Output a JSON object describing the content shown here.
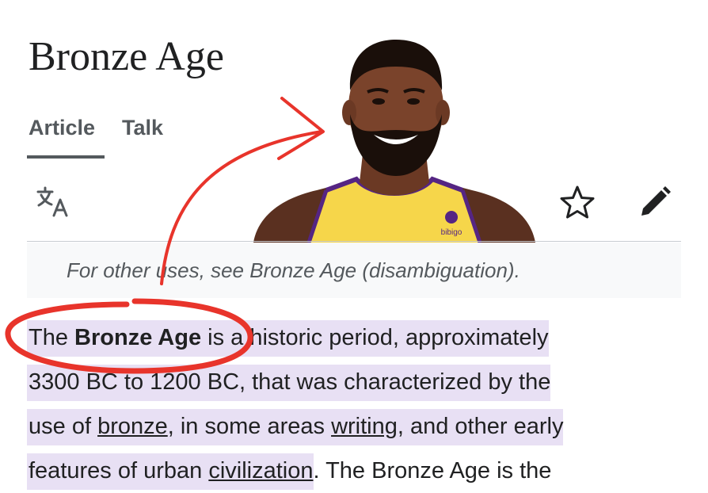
{
  "page": {
    "title": "Bronze Age"
  },
  "tabs": [
    {
      "label": "Article",
      "active": true
    },
    {
      "label": "Talk",
      "active": false
    }
  ],
  "toolbar": {
    "language_icon": "translate-icon",
    "watch_icon": "star-icon",
    "edit_icon": "pencil-icon"
  },
  "portrait": {
    "jersey_logo": "bibigo"
  },
  "hatnote": {
    "prefix": "For other uses, see ",
    "link": "Bronze Age (disambiguation)",
    "suffix": "."
  },
  "intro": {
    "line1_a": "The ",
    "line1_bold": "Bronze Age",
    "line1_b": " is a historic period, approximately",
    "line2": "3300 BC to 1200 BC, that was characterized by the",
    "line3_a": "use of ",
    "line3_link1": "bronze",
    "line3_b": ", in some areas ",
    "line3_link2": "writing",
    "line3_c": ", and other early",
    "line4_a": "features of urban ",
    "line4_link": "civilization",
    "line4_b": ". The Bronze Age is the"
  },
  "annotations": {
    "circle_color": "#e8342b",
    "arrow_color": "#e8342b"
  },
  "colors": {
    "highlight": "#e8e0f4",
    "text": "#202122",
    "muted": "#54595d"
  }
}
